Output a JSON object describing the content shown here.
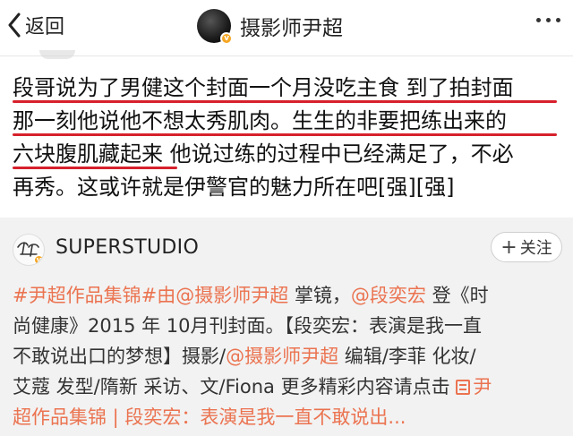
{
  "nav": {
    "back_label": "返回",
    "title": "摄影师尹超"
  },
  "post": {
    "lines": [
      "段哥说为了男健这个封面一个月没吃主食 到了拍封面",
      "那一刻他说他不想太秀肌肉。生生的非要把练出来的",
      "六块腹肌藏起来 他说过练的过程中已经满足了，不必",
      "再秀。这或许就是伊警官的魅力所在吧[强][强]"
    ]
  },
  "repost": {
    "name": "SUPERSTUDIO",
    "follow_label": "关注",
    "line1": {
      "tag1": "#尹超作品集锦",
      "tag2": "#由",
      "mention1": "@摄影师尹超",
      "text1": " 掌镜，",
      "mention2": "@段奕宏",
      "text2": " 登《时"
    },
    "line2": "尚健康》2015 年 10月刊封面。【段奕宏：表演是我一直",
    "line3": {
      "text1": "不敢说出口的梦想】摄影/",
      "mention1": "@摄影师尹超",
      "text2": " 编辑/李菲 化妆/"
    },
    "line4": {
      "text1": "艾蔻 发型/隋新 采访、文/Fiona 更多精彩内容请点击 ",
      "link1": "尹"
    },
    "line5": {
      "link1": "超作品集锦 | 段奕宏：表演是我一直不敢说出..."
    }
  },
  "colors": {
    "link": "#eb7350",
    "underline": "#d6212c",
    "repost_bg": "#f2f2f2",
    "verified": "#f5a623"
  }
}
